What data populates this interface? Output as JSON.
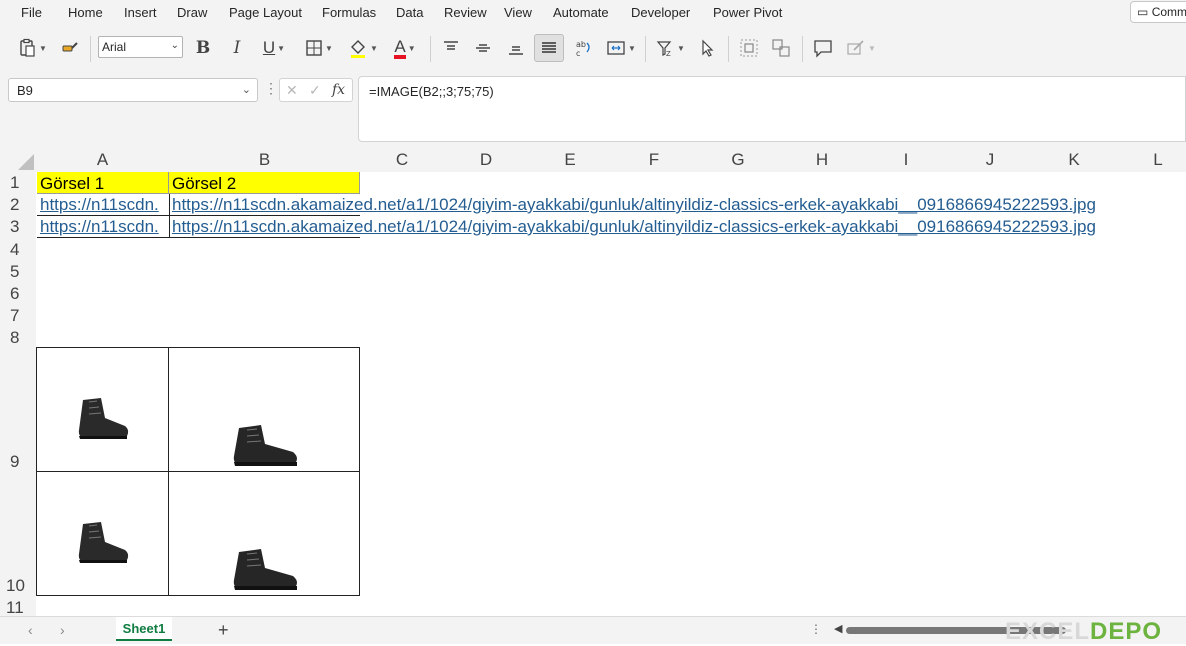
{
  "menu": [
    "File",
    "Home",
    "Insert",
    "Draw",
    "Page Layout",
    "Formulas",
    "Data",
    "Review",
    "View",
    "Automate",
    "Developer",
    "Power Pivot"
  ],
  "comments_label": "Comments",
  "ribbon": {
    "font_name": "Arial",
    "bold": "B",
    "italic": "I",
    "underline": "U",
    "font_color_glyph": "A"
  },
  "formula_bar": {
    "name_box": "B9",
    "formula": "=IMAGE(B2;;3;75;75)",
    "fx": "fx",
    "cancel": "✕",
    "enter": "✓"
  },
  "columns": [
    "A",
    "B",
    "C",
    "D",
    "E",
    "F",
    "G",
    "H",
    "I",
    "J",
    "K",
    "L"
  ],
  "rows": [
    "1",
    "2",
    "3",
    "4",
    "5",
    "6",
    "7",
    "8",
    "9",
    "10",
    "11"
  ],
  "cells": {
    "A1": "Görsel 1",
    "B1": "Görsel 2",
    "A2": "https://n11scdn.",
    "B2": "https://n11scdn.akamaized.net/a1/1024/giyim-ayakkabi/gunluk/altinyildiz-classics-erkek-ayakkabi__0916866945222593.jpg",
    "A3": "https://n11scdn.",
    "B3": "https://n11scdn.akamaized.net/a1/1024/giyim-ayakkabi/gunluk/altinyildiz-classics-erkek-ayakkabi__0916866945222593.jpg"
  },
  "sheets": {
    "active": "Sheet1"
  },
  "watermark": {
    "text1": "EXCEL",
    "text2": "DEPO"
  },
  "colors": {
    "header_fill": "#ffff00",
    "link": "#245d91",
    "accent": "#107c41"
  }
}
